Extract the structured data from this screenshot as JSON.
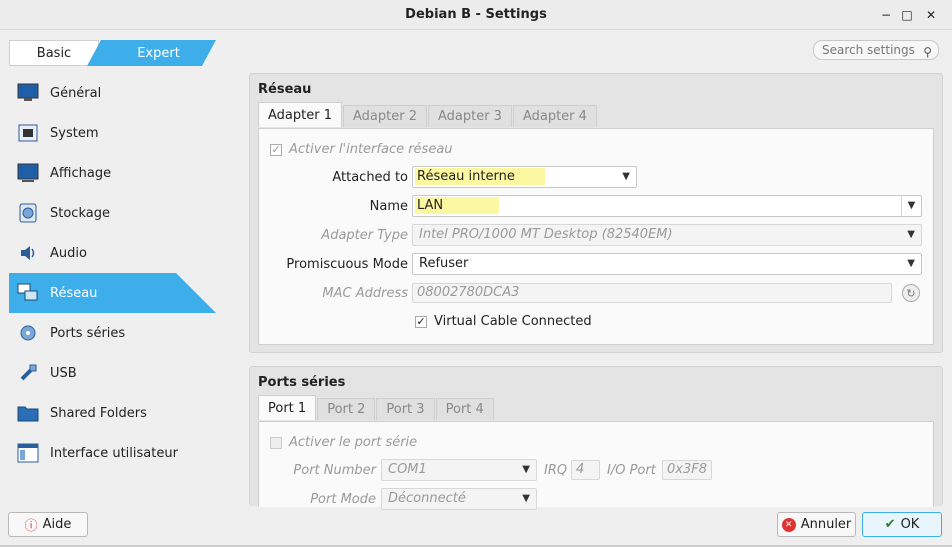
{
  "window": {
    "title": "Debian B - Settings"
  },
  "mode": {
    "basic": "Basic",
    "expert": "Expert"
  },
  "search": {
    "placeholder": "Search settings"
  },
  "sidebar": {
    "items": [
      {
        "label": "Général",
        "icon": "general-icon"
      },
      {
        "label": "System",
        "icon": "system-icon"
      },
      {
        "label": "Affichage",
        "icon": "display-icon"
      },
      {
        "label": "Stockage",
        "icon": "storage-icon"
      },
      {
        "label": "Audio",
        "icon": "audio-icon"
      },
      {
        "label": "Réseau",
        "icon": "network-icon",
        "active": true
      },
      {
        "label": "Ports séries",
        "icon": "serial-ports-icon"
      },
      {
        "label": "USB",
        "icon": "usb-icon"
      },
      {
        "label": "Shared Folders",
        "icon": "shared-folders-icon"
      },
      {
        "label": "Interface utilisateur",
        "icon": "user-interface-icon"
      }
    ]
  },
  "network": {
    "title": "Réseau",
    "tabs": [
      "Adapter 1",
      "Adapter 2",
      "Adapter 3",
      "Adapter 4"
    ],
    "enable_label": "Activer l'interface réseau",
    "attached_label": "Attached to",
    "attached_value": "Réseau interne",
    "name_label": "Name",
    "name_value": "LAN",
    "adapter_type_label": "Adapter Type",
    "adapter_type_value": "Intel PRO/1000 MT Desktop (82540EM)",
    "promiscuous_label": "Promiscuous Mode",
    "promiscuous_value": "Refuser",
    "mac_label": "MAC Address",
    "mac_value": "08002780DCA3",
    "cable_label": "Virtual Cable Connected"
  },
  "serial": {
    "title": "Ports séries",
    "tabs": [
      "Port 1",
      "Port 2",
      "Port 3",
      "Port 4"
    ],
    "enable_label": "Activer le port série",
    "port_number_label": "Port Number",
    "port_number_value": "COM1",
    "irq_label": "IRQ",
    "irq_value": "4",
    "io_label": "I/O Port",
    "io_value": "0x3F8",
    "port_mode_label": "Port Mode",
    "port_mode_value": "Déconnecté"
  },
  "buttons": {
    "help": "Aide",
    "cancel": "Annuler",
    "ok": "OK"
  },
  "colors": {
    "accent": "#3daee9",
    "highlight": "#fcf7a1"
  }
}
